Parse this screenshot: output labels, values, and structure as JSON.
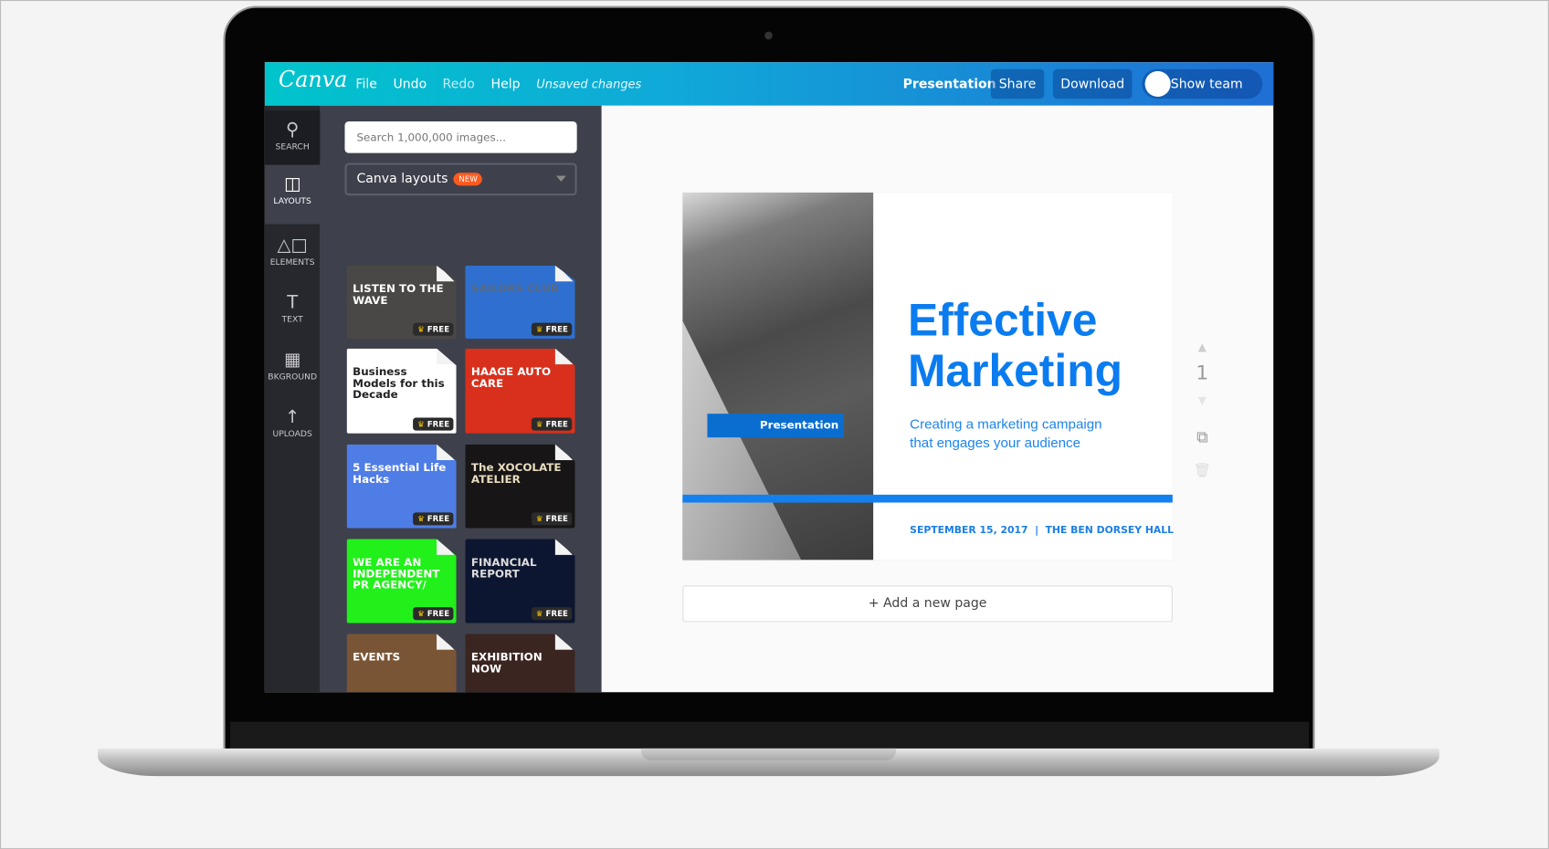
{
  "header": {
    "logo": "Canva",
    "menu": [
      "File",
      "Undo",
      "Redo",
      "Help"
    ],
    "status": "Unsaved changes",
    "doc_type": "Presentation",
    "share": "Share",
    "download": "Download",
    "show_team": "Show team",
    "gradient": [
      "#00c4cc",
      "#1f6fd4"
    ]
  },
  "rail": [
    {
      "label": "SEARCH",
      "icon": "search-icon"
    },
    {
      "label": "LAYOUTS",
      "icon": "layouts-icon"
    },
    {
      "label": "ELEMENTS",
      "icon": "elements-icon"
    },
    {
      "label": "TEXT",
      "icon": "text-icon"
    },
    {
      "label": "BKGROUND",
      "icon": "background-icon"
    },
    {
      "label": "UPLOADS",
      "icon": "upload-icon"
    }
  ],
  "panel": {
    "search_placeholder": "Search 1,000,000 images...",
    "dropdown": "Canva layouts",
    "new_badge": "NEW",
    "free_label": "FREE",
    "layouts": [
      {
        "text": "LISTEN TO THE WAVE",
        "bg": "#4a4846",
        "fg": "#ffffff"
      },
      {
        "text": "SAILORS CLUB",
        "bg": "#2f6fd0",
        "fg": "#5a6a80"
      },
      {
        "text": "Business Models for this Decade",
        "bg": "#ffffff",
        "fg": "#222222"
      },
      {
        "text": "HAAGE AUTO CARE",
        "bg": "#d8301c",
        "fg": "#ffffff"
      },
      {
        "text": "5 Essential Life Hacks",
        "bg": "#4f7de6",
        "fg": "#ffffff"
      },
      {
        "text": "The XOCOLATE ATELIER",
        "bg": "#171515",
        "fg": "#e9dcc0"
      },
      {
        "text": "WE ARE AN INDEPENDENT PR AGENCY/",
        "bg": "#22f01a",
        "fg": "#ffffff"
      },
      {
        "text": "FINANCIAL REPORT",
        "bg": "#0d1630",
        "fg": "#dddddd"
      },
      {
        "text": "EVENTS",
        "bg": "#7a5535",
        "fg": "#ffffff"
      },
      {
        "text": "EXHIBITION NOW",
        "bg": "#3a2520",
        "fg": "#ffffff"
      },
      {
        "text": "",
        "bg": "#2e1f4a",
        "fg": "#ffffff"
      },
      {
        "text": "",
        "bg": "#b7a89a",
        "fg": "#ffffff"
      }
    ]
  },
  "slide": {
    "tag": "Presentation",
    "title_line1": "Effective",
    "title_line2": "Marketing",
    "subtitle_line1": "Creating a marketing campaign",
    "subtitle_line2": "that engages your audience",
    "footer": "SEPTEMBER 15, 2017  |  THE BEN DORSEY HALL",
    "accent": "#0a7cf0"
  },
  "page_controls": {
    "page_number": "1"
  },
  "add_page": "+ Add a new page"
}
